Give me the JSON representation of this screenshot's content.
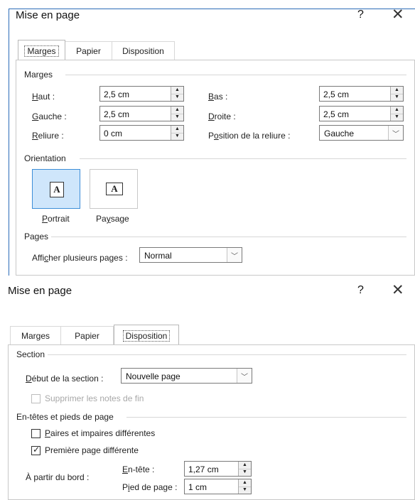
{
  "dialog1": {
    "title": "Mise en page",
    "help": "?",
    "close": "✕",
    "tabs": [
      "Marges",
      "Papier",
      "Disposition"
    ],
    "margins": {
      "section": "Marges",
      "haut_label": "aut :",
      "haut_key": "H",
      "haut_value": "2,5 cm",
      "gauche_label": "auche :",
      "gauche_key": "G",
      "gauche_value": "2,5 cm",
      "reliure_label": "eliure :",
      "reliure_key": "R",
      "reliure_value": "0 cm",
      "bas_label": "as :",
      "bas_key": "B",
      "bas_value": "2,5 cm",
      "droite_label": "roite :",
      "droite_key": "D",
      "droite_value": "2,5 cm",
      "position_label_a": "P",
      "position_key": "o",
      "position_label_b": "sition de la reliure :",
      "position_value": "Gauche"
    },
    "orientation": {
      "section": "Orientation",
      "portrait_key": "P",
      "portrait_rest": "ortrait",
      "paysage_a": "Pa",
      "paysage_key": "y",
      "paysage_b": "sage",
      "icon_letter": "A"
    },
    "pages": {
      "section": "Pages",
      "label_a": "Affi",
      "label_key": "c",
      "label_b": "her plusieurs pages :",
      "value": "Normal"
    }
  },
  "dialog2": {
    "title": "Mise en page",
    "help": "?",
    "close": "✕",
    "tabs": [
      "Marges",
      "Papier",
      "Disposition"
    ],
    "section": {
      "title": "Section",
      "debut_key": "D",
      "debut_rest": "ébut de la section :",
      "debut_value": "Nouvelle page",
      "suppress": "Supprimer les notes de fin"
    },
    "headers": {
      "title": "En-têtes et pieds de page",
      "paires_key": "P",
      "paires_rest": "aires et impaires différentes",
      "premiere_a": "Première pa",
      "premiere_key": "g",
      "premiere_b": "e différente",
      "bord": "À partir du bord :",
      "entete_key": "E",
      "entete_rest": "n-tête :",
      "entete_value": "1,27 cm",
      "pied_a": "P",
      "pied_key": "i",
      "pied_b": "ed de page :",
      "pied_value": "1 cm"
    }
  }
}
